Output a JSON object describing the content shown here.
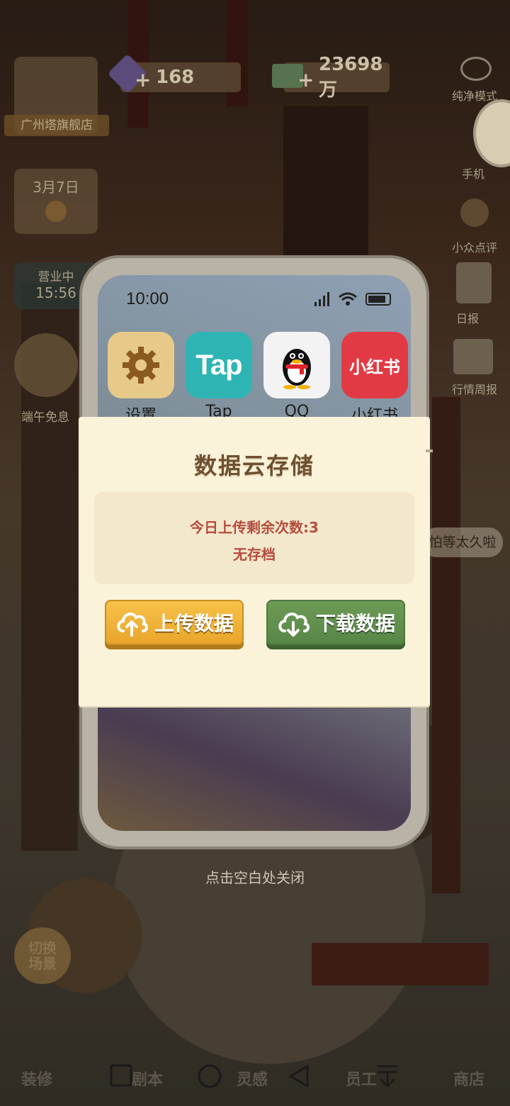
{
  "hud": {
    "gems": "168",
    "cash": "23698万",
    "plus": "+",
    "store_name": "广州塔旗舰店",
    "date": "3月7日",
    "status_label": "营业中",
    "status_time": "15:56",
    "event_label": "端午免息"
  },
  "right_sidebar": {
    "pure_mode": "纯净模式",
    "phone": "手机",
    "reviews": "小众点评",
    "daily": "日报",
    "market": "行情周报",
    "bubble": "怕等太久啦"
  },
  "phone_mock": {
    "time": "10:00",
    "apps": [
      {
        "label": "设置",
        "icon": "gear-icon",
        "color": "#e7c98a"
      },
      {
        "label": "Tap",
        "icon": "tap-logo",
        "color": "#2fb4b4"
      },
      {
        "label": "QQ",
        "icon": "penguin-icon",
        "color": "#f3f3f3"
      },
      {
        "label": "小红书",
        "icon": "xiaohongshu-logo",
        "color": "#e23a44"
      }
    ],
    "tap_text": "Tap",
    "xhs_text": "小红书"
  },
  "dialog": {
    "title": "数据云存储",
    "remaining": "今日上传剩余次数:3",
    "save_status": "无存档",
    "upload_label": "上传数据",
    "download_label": "下载数据"
  },
  "close_hint": "点击空白处关闭",
  "switch_scene": "切换场景",
  "bottom_tabs": [
    "装修",
    "剧本",
    "灵感",
    "员工",
    "商店"
  ],
  "colors": {
    "dialog_bg": "#fbf2da",
    "info_text": "#b44c3e",
    "upload_btn": "#eeaf35",
    "download_btn": "#62904f",
    "title_text": "#6d5030"
  }
}
